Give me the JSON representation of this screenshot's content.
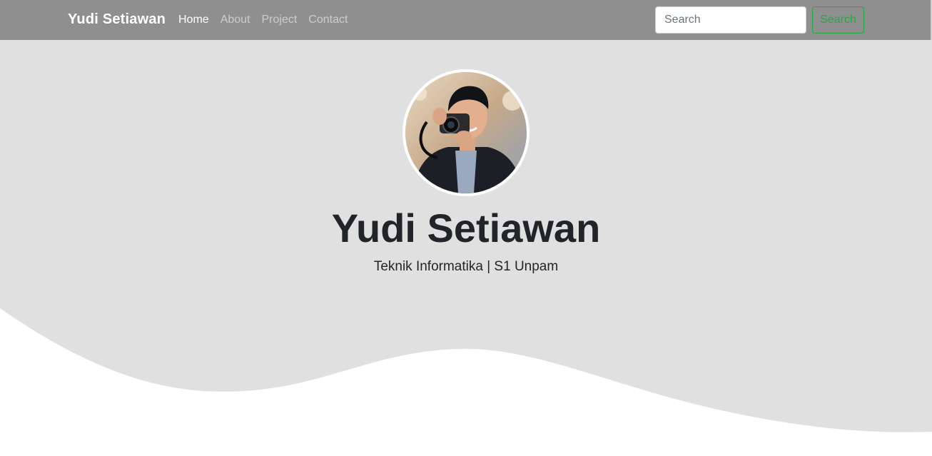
{
  "navbar": {
    "brand": "Yudi Setiawan",
    "links": [
      {
        "label": "Home",
        "active": true
      },
      {
        "label": "About",
        "active": false
      },
      {
        "label": "Project",
        "active": false
      },
      {
        "label": "Contact",
        "active": false
      }
    ],
    "search": {
      "placeholder": "Search",
      "value": "",
      "button_label": "Search"
    }
  },
  "hero": {
    "avatar_icon": "profile-photo",
    "name": "Yudi Setiawan",
    "subtitle": "Teknik Informatika | S1 Unpam"
  },
  "colors": {
    "navbar_bg": "#8f8f8f",
    "hero_bg": "#e0e0e0",
    "accent_success": "#28a745",
    "text_dark": "#212529"
  }
}
